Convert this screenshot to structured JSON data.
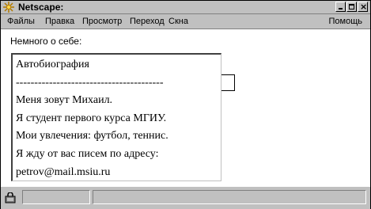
{
  "window": {
    "title": "Netscape:",
    "controls": [
      "minimize",
      "maximize",
      "close"
    ]
  },
  "menubar": {
    "items": [
      "Файлы",
      "Правка",
      "Просмотр",
      "Переход",
      "Скна"
    ],
    "help": "Помощь"
  },
  "content": {
    "section_label": "Немного о себе:",
    "textarea": {
      "lines": [
        "Автобиография",
        "----------------------------------------",
        "Меня зовут Михаил.",
        "Я студент первого курса МГИУ.",
        "Мои увлечения: футбол, теннис.",
        "Я жду от вас писем по адресу:",
        "petrov@mail.msiu.ru"
      ]
    }
  },
  "statusbar": {
    "icon": "security-lock-icon",
    "field1": "",
    "field2": ""
  }
}
